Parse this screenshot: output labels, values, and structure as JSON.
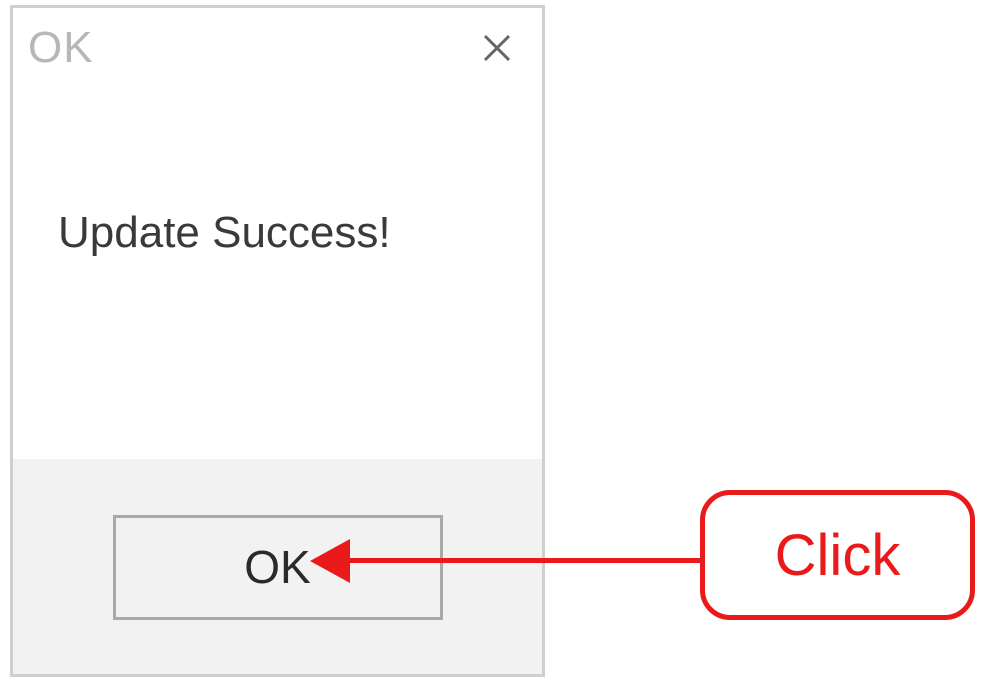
{
  "dialog": {
    "title": "OK",
    "message": "Update Success!",
    "ok_label": "OK"
  },
  "annotation": {
    "label": "Click"
  }
}
